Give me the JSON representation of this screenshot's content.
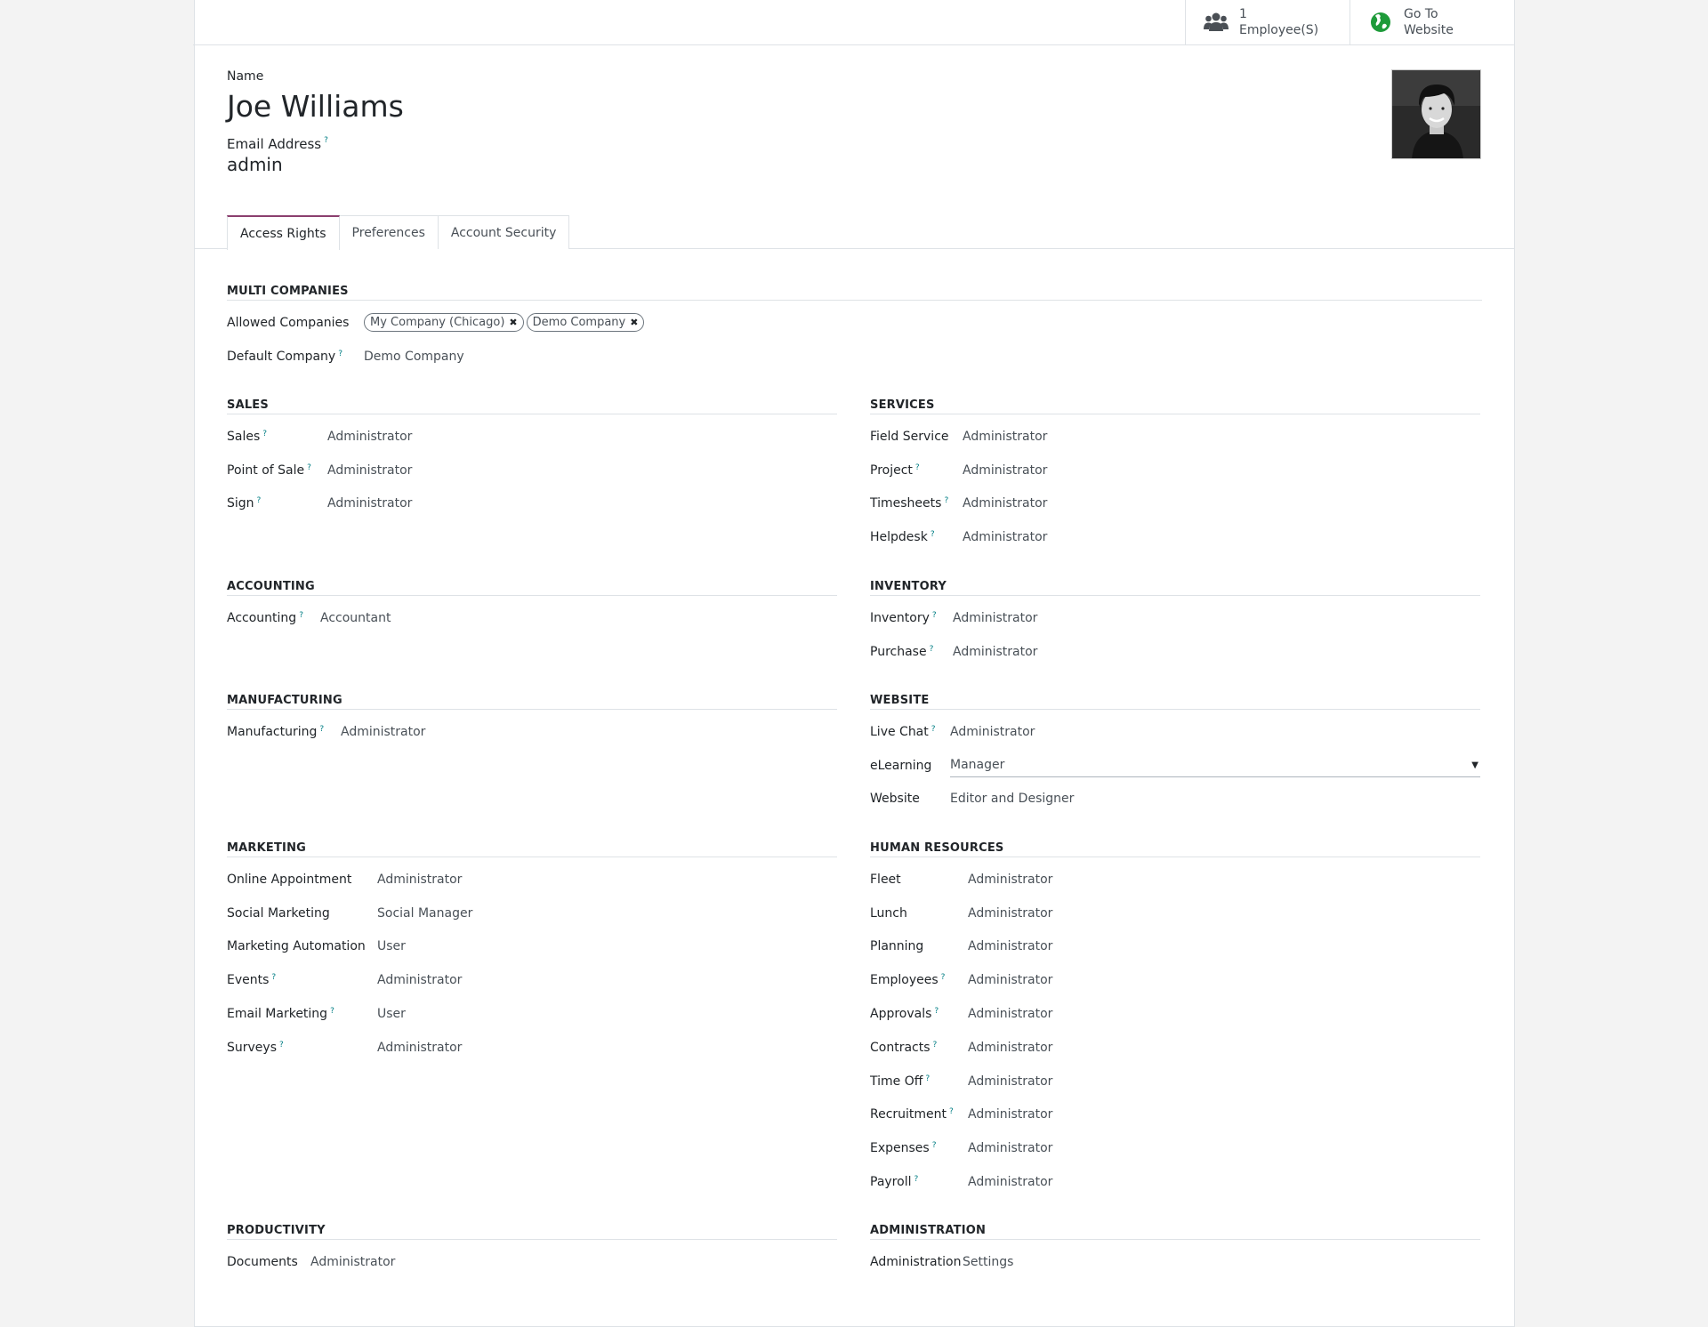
{
  "stat_buttons": {
    "employees": {
      "count": "1",
      "label": "Employee(S)"
    },
    "website": {
      "line1": "Go To",
      "line2": "Website"
    }
  },
  "header": {
    "name_label": "Name",
    "name": "Joe Williams",
    "email_label": "Email Address",
    "email": "admin",
    "help_mark": "?"
  },
  "tabs": [
    "Access Rights",
    "Preferences",
    "Account Security"
  ],
  "multi_companies": {
    "title": "MULTI COMPANIES",
    "allowed_label": "Allowed Companies",
    "allowed": [
      "My Company (Chicago)",
      "Demo Company"
    ],
    "remove_glyph": "✖",
    "default_label": "Default Company",
    "default_value": "Demo Company"
  },
  "left_sections": [
    {
      "title": "SALES",
      "rows": [
        {
          "label": "Sales",
          "value": "Administrator",
          "help": true
        },
        {
          "label": "Point of Sale",
          "value": "Administrator",
          "help": true
        },
        {
          "label": "Sign",
          "value": "Administrator",
          "help": true
        }
      ]
    },
    {
      "title": "ACCOUNTING",
      "rows": [
        {
          "label": "Accounting",
          "value": "Accountant",
          "help": true
        }
      ]
    },
    {
      "title": "MANUFACTURING",
      "rows": [
        {
          "label": "Manufacturing",
          "value": "Administrator",
          "help": true
        }
      ]
    },
    {
      "title": "MARKETING",
      "rows": [
        {
          "label": "Online Appointment",
          "value": "Administrator",
          "help": false
        },
        {
          "label": "Social Marketing",
          "value": "Social Manager",
          "help": false
        },
        {
          "label": "Marketing Automation",
          "value": "User",
          "help": false
        },
        {
          "label": "Events",
          "value": "Administrator",
          "help": true
        },
        {
          "label": "Email Marketing",
          "value": "User",
          "help": true
        },
        {
          "label": "Surveys",
          "value": "Administrator",
          "help": true
        }
      ]
    },
    {
      "title": "PRODUCTIVITY",
      "rows": [
        {
          "label": "Documents",
          "value": "Administrator",
          "help": false
        }
      ]
    }
  ],
  "right_sections": [
    {
      "title": "SERVICES",
      "rows": [
        {
          "label": "Field Service",
          "value": "Administrator",
          "help": false
        },
        {
          "label": "Project",
          "value": "Administrator",
          "help": true
        },
        {
          "label": "Timesheets",
          "value": "Administrator",
          "help": true
        },
        {
          "label": "Helpdesk",
          "value": "Administrator",
          "help": true
        }
      ]
    },
    {
      "title": "INVENTORY",
      "rows": [
        {
          "label": "Inventory",
          "value": "Administrator",
          "help": true
        },
        {
          "label": "Purchase",
          "value": "Administrator",
          "help": true
        }
      ]
    },
    {
      "title": "WEBSITE",
      "rows": [
        {
          "label": "Live Chat",
          "value": "Administrator",
          "help": true
        },
        {
          "label": "eLearning",
          "value": "Manager",
          "help": false,
          "select": true
        },
        {
          "label": "Website",
          "value": "Editor and Designer",
          "help": false
        }
      ]
    },
    {
      "title": "HUMAN RESOURCES",
      "rows": [
        {
          "label": "Fleet",
          "value": "Administrator",
          "help": false
        },
        {
          "label": "Lunch",
          "value": "Administrator",
          "help": false
        },
        {
          "label": "Planning",
          "value": "Administrator",
          "help": false
        },
        {
          "label": "Employees",
          "value": "Administrator",
          "help": true
        },
        {
          "label": "Approvals",
          "value": "Administrator",
          "help": true
        },
        {
          "label": "Contracts",
          "value": "Administrator",
          "help": true
        },
        {
          "label": "Time Off",
          "value": "Administrator",
          "help": true
        },
        {
          "label": "Recruitment",
          "value": "Administrator",
          "help": true
        },
        {
          "label": "Expenses",
          "value": "Administrator",
          "help": true
        },
        {
          "label": "Payroll",
          "value": "Administrator",
          "help": true
        }
      ]
    },
    {
      "title": "ADMINISTRATION",
      "rows": [
        {
          "label": "Administration",
          "value": "Settings",
          "help": false
        }
      ]
    }
  ]
}
